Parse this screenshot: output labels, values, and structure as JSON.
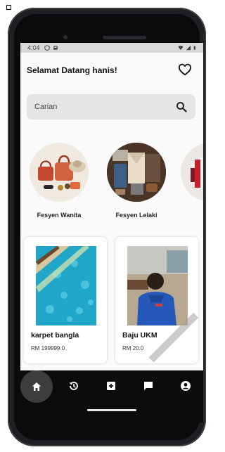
{
  "status_bar": {
    "time": "4:04"
  },
  "header": {
    "greeting": "Selamat Datang hanis!"
  },
  "search": {
    "placeholder": "Carian"
  },
  "categories": [
    {
      "label": "Fesyen Wanita"
    },
    {
      "label": "Fesyen Lelaki"
    }
  ],
  "products": [
    {
      "name": "karpet bangla",
      "price": "RM 199999.0"
    },
    {
      "name": "Baju UKM",
      "price": "RM 20.0"
    }
  ],
  "nav": {
    "items": [
      "home-icon",
      "history-icon",
      "add-box-icon",
      "chat-icon",
      "account-icon"
    ],
    "active": "home-icon"
  },
  "colors": {
    "background": "#fafafb",
    "search_bg": "#e5e5e7",
    "nav_bg": "#0b0b0c",
    "nav_active": "#3d3d40"
  }
}
